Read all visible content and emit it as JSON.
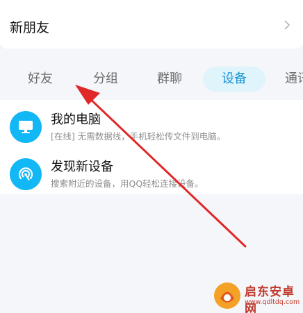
{
  "new_friends": {
    "label": "新朋友"
  },
  "tabs": [
    {
      "label": "好友",
      "active": false
    },
    {
      "label": "分组",
      "active": false
    },
    {
      "label": "群聊",
      "active": false
    },
    {
      "label": "设备",
      "active": true
    },
    {
      "label": "通讯",
      "active": false
    }
  ],
  "devices": [
    {
      "title": "我的电脑",
      "status": "[在线]",
      "description": "无需数据线，手机轻松传文件到电脑。",
      "icon": "monitor-icon"
    },
    {
      "title": "发现新设备",
      "status": "",
      "description": "搜索附近的设备，用QQ轻松连接设备。",
      "icon": "radar-icon"
    }
  ],
  "colors": {
    "accent": "#12b7f5",
    "active_tab_bg": "#dff4fb",
    "active_tab_text": "#1a93d6",
    "annotation_arrow": "#e02828",
    "background": "#f5f6fa"
  },
  "watermark": {
    "name": "启东安卓网",
    "url": "www.qdltdq.com"
  }
}
